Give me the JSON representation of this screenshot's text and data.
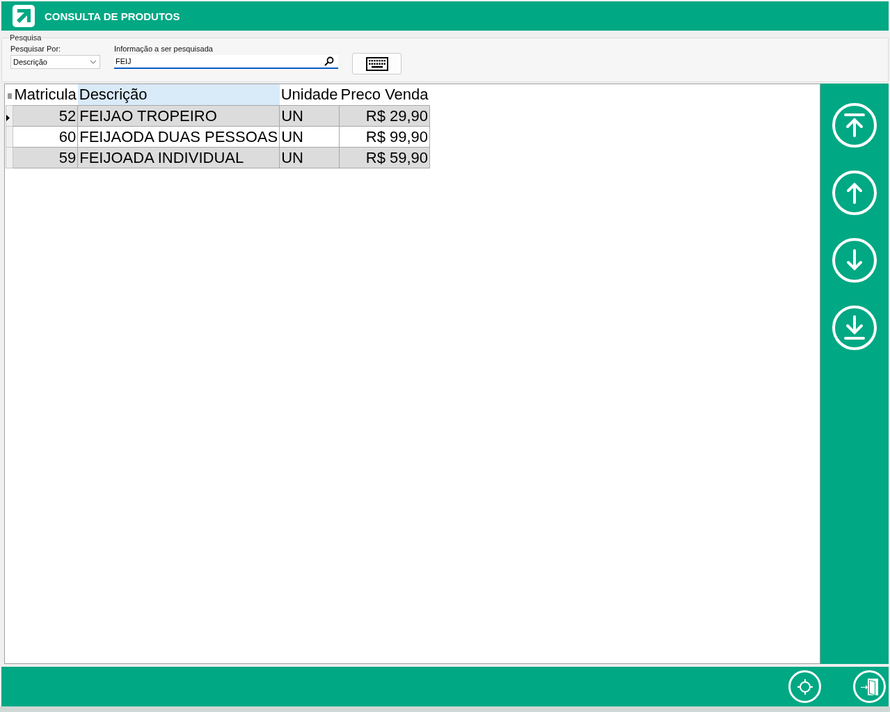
{
  "window": {
    "title": "CONSULTA DE PRODUTOS"
  },
  "search": {
    "group_label": "Pesquisa",
    "by_label": "Pesquisar Por:",
    "by_value": "Descrição",
    "info_label": "Informação a ser pesquisada",
    "info_value": "FEIJ"
  },
  "table": {
    "columns": [
      {
        "label": "Matricula",
        "selected": false,
        "kind": "number"
      },
      {
        "label": "Descrição",
        "selected": true,
        "kind": "text"
      },
      {
        "label": "Unidade",
        "selected": false,
        "kind": "text"
      },
      {
        "label": "Preco Venda",
        "selected": false,
        "kind": "number"
      }
    ],
    "rows": [
      {
        "current": true,
        "cells": [
          "52",
          "FEIJAO TROPEIRO",
          "UN",
          "R$ 29,90"
        ]
      },
      {
        "current": false,
        "cells": [
          "60",
          "FEIJAODA DUAS PESSOAS",
          "UN",
          "R$ 99,90"
        ]
      },
      {
        "current": false,
        "cells": [
          "59",
          "FEIJOADA INDIVIDUAL",
          "UN",
          "R$ 59,90"
        ]
      }
    ]
  },
  "nav_buttons": [
    {
      "kind": "first"
    },
    {
      "kind": "previous"
    },
    {
      "kind": "next"
    },
    {
      "kind": "last"
    }
  ],
  "footer_buttons": [
    {
      "kind": "locate"
    },
    {
      "kind": "exit"
    }
  ]
}
